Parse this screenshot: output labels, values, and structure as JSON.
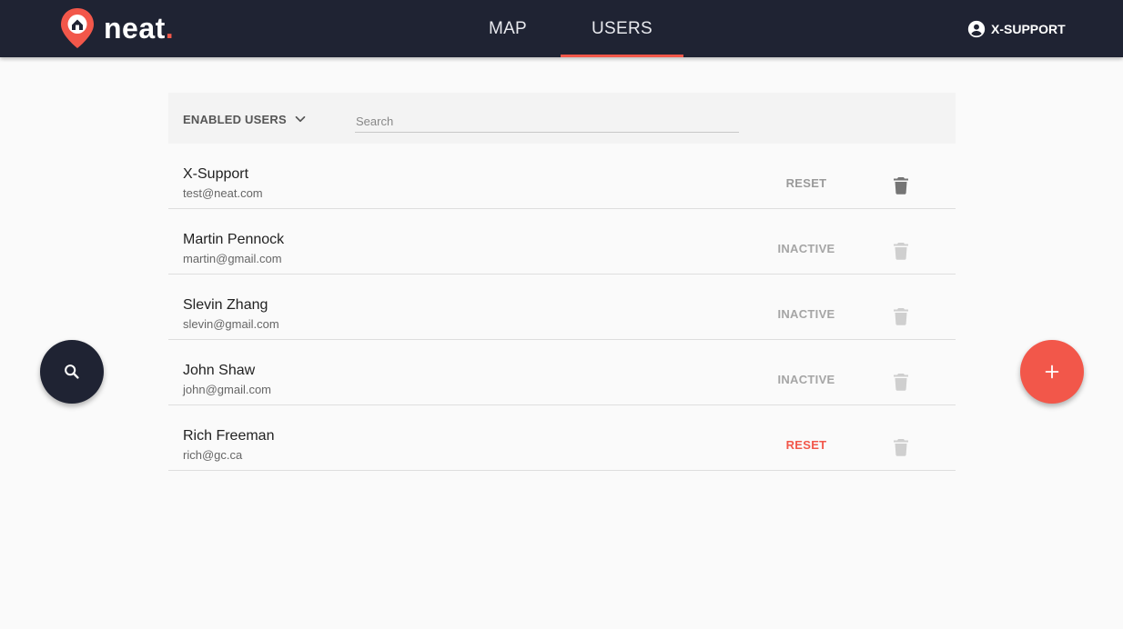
{
  "brand": {
    "name": "neat",
    "dot": ".",
    "accent": "#f2574a",
    "navy": "#1f2333"
  },
  "nav": {
    "tabs": [
      {
        "label": "MAP"
      },
      {
        "label": "USERS",
        "active": true
      }
    ]
  },
  "account": {
    "label": "X-SUPPORT",
    "icon": "account-circle-icon"
  },
  "filter": {
    "label": "ENABLED USERS",
    "icon": "chevron-down-icon"
  },
  "search": {
    "placeholder": "Search",
    "value": ""
  },
  "users": [
    {
      "name": "X-Support",
      "email": "test@neat.com",
      "action": "RESET",
      "action_color": "#9a9a9a",
      "delete_color": "#757575"
    },
    {
      "name": "Martin Pennock",
      "email": "martin@gmail.com",
      "action": "INACTIVE",
      "action_color": "#a5a5a5",
      "delete_color": "#cfcfcf"
    },
    {
      "name": "Slevin Zhang",
      "email": "slevin@gmail.com",
      "action": "INACTIVE",
      "action_color": "#a5a5a5",
      "delete_color": "#cfcfcf"
    },
    {
      "name": "John Shaw",
      "email": "john@gmail.com",
      "action": "INACTIVE",
      "action_color": "#a5a5a5",
      "delete_color": "#cfcfcf"
    },
    {
      "name": "Rich Freeman",
      "email": "rich@gc.ca",
      "action": "RESET",
      "action_color": "#f2574a",
      "delete_color": "#cfcfcf"
    }
  ],
  "fabs": {
    "search_icon": "search-icon",
    "add_icon": "plus-icon"
  }
}
